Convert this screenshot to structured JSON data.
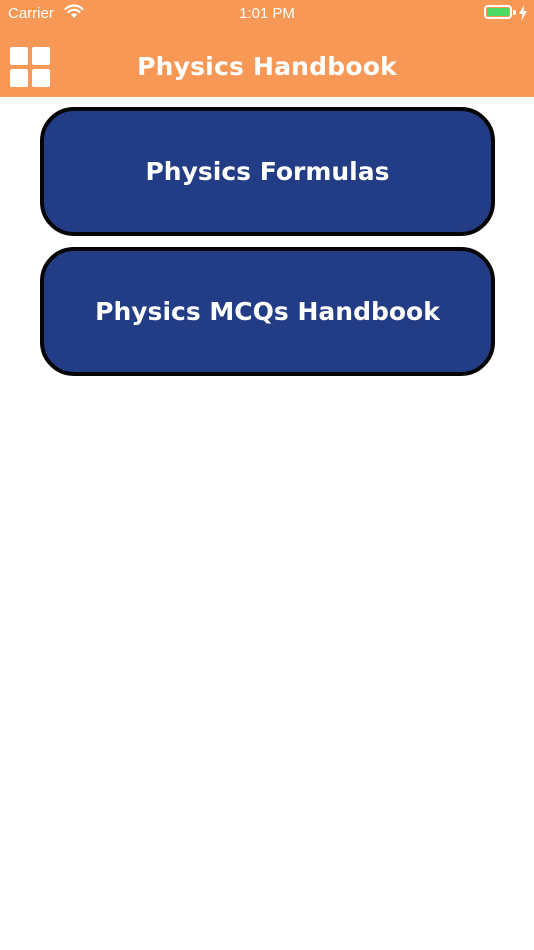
{
  "status_bar": {
    "carrier": "Carrier",
    "time": "1:01 PM",
    "battery_level": 1.0,
    "battery_color": "#4CD964"
  },
  "nav": {
    "title": "Physics Handbook",
    "menu_icon": "grid-menu-icon",
    "background_color": "#F79856"
  },
  "menu": {
    "items": [
      {
        "label": "Physics Formulas"
      },
      {
        "label": "Physics MCQs Handbook"
      }
    ],
    "card_color": "#223C86"
  }
}
